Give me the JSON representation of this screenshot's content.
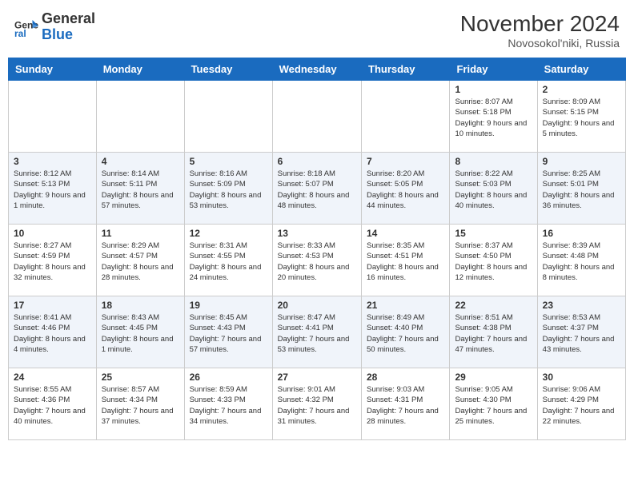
{
  "header": {
    "logo_line1": "General",
    "logo_line2": "Blue",
    "month": "November 2024",
    "location": "Novosokol'niki, Russia"
  },
  "weekdays": [
    "Sunday",
    "Monday",
    "Tuesday",
    "Wednesday",
    "Thursday",
    "Friday",
    "Saturday"
  ],
  "weeks": [
    [
      {
        "day": "",
        "info": ""
      },
      {
        "day": "",
        "info": ""
      },
      {
        "day": "",
        "info": ""
      },
      {
        "day": "",
        "info": ""
      },
      {
        "day": "",
        "info": ""
      },
      {
        "day": "1",
        "info": "Sunrise: 8:07 AM\nSunset: 5:18 PM\nDaylight: 9 hours and 10 minutes."
      },
      {
        "day": "2",
        "info": "Sunrise: 8:09 AM\nSunset: 5:15 PM\nDaylight: 9 hours and 5 minutes."
      }
    ],
    [
      {
        "day": "3",
        "info": "Sunrise: 8:12 AM\nSunset: 5:13 PM\nDaylight: 9 hours and 1 minute."
      },
      {
        "day": "4",
        "info": "Sunrise: 8:14 AM\nSunset: 5:11 PM\nDaylight: 8 hours and 57 minutes."
      },
      {
        "day": "5",
        "info": "Sunrise: 8:16 AM\nSunset: 5:09 PM\nDaylight: 8 hours and 53 minutes."
      },
      {
        "day": "6",
        "info": "Sunrise: 8:18 AM\nSunset: 5:07 PM\nDaylight: 8 hours and 48 minutes."
      },
      {
        "day": "7",
        "info": "Sunrise: 8:20 AM\nSunset: 5:05 PM\nDaylight: 8 hours and 44 minutes."
      },
      {
        "day": "8",
        "info": "Sunrise: 8:22 AM\nSunset: 5:03 PM\nDaylight: 8 hours and 40 minutes."
      },
      {
        "day": "9",
        "info": "Sunrise: 8:25 AM\nSunset: 5:01 PM\nDaylight: 8 hours and 36 minutes."
      }
    ],
    [
      {
        "day": "10",
        "info": "Sunrise: 8:27 AM\nSunset: 4:59 PM\nDaylight: 8 hours and 32 minutes."
      },
      {
        "day": "11",
        "info": "Sunrise: 8:29 AM\nSunset: 4:57 PM\nDaylight: 8 hours and 28 minutes."
      },
      {
        "day": "12",
        "info": "Sunrise: 8:31 AM\nSunset: 4:55 PM\nDaylight: 8 hours and 24 minutes."
      },
      {
        "day": "13",
        "info": "Sunrise: 8:33 AM\nSunset: 4:53 PM\nDaylight: 8 hours and 20 minutes."
      },
      {
        "day": "14",
        "info": "Sunrise: 8:35 AM\nSunset: 4:51 PM\nDaylight: 8 hours and 16 minutes."
      },
      {
        "day": "15",
        "info": "Sunrise: 8:37 AM\nSunset: 4:50 PM\nDaylight: 8 hours and 12 minutes."
      },
      {
        "day": "16",
        "info": "Sunrise: 8:39 AM\nSunset: 4:48 PM\nDaylight: 8 hours and 8 minutes."
      }
    ],
    [
      {
        "day": "17",
        "info": "Sunrise: 8:41 AM\nSunset: 4:46 PM\nDaylight: 8 hours and 4 minutes."
      },
      {
        "day": "18",
        "info": "Sunrise: 8:43 AM\nSunset: 4:45 PM\nDaylight: 8 hours and 1 minute."
      },
      {
        "day": "19",
        "info": "Sunrise: 8:45 AM\nSunset: 4:43 PM\nDaylight: 7 hours and 57 minutes."
      },
      {
        "day": "20",
        "info": "Sunrise: 8:47 AM\nSunset: 4:41 PM\nDaylight: 7 hours and 53 minutes."
      },
      {
        "day": "21",
        "info": "Sunrise: 8:49 AM\nSunset: 4:40 PM\nDaylight: 7 hours and 50 minutes."
      },
      {
        "day": "22",
        "info": "Sunrise: 8:51 AM\nSunset: 4:38 PM\nDaylight: 7 hours and 47 minutes."
      },
      {
        "day": "23",
        "info": "Sunrise: 8:53 AM\nSunset: 4:37 PM\nDaylight: 7 hours and 43 minutes."
      }
    ],
    [
      {
        "day": "24",
        "info": "Sunrise: 8:55 AM\nSunset: 4:36 PM\nDaylight: 7 hours and 40 minutes."
      },
      {
        "day": "25",
        "info": "Sunrise: 8:57 AM\nSunset: 4:34 PM\nDaylight: 7 hours and 37 minutes."
      },
      {
        "day": "26",
        "info": "Sunrise: 8:59 AM\nSunset: 4:33 PM\nDaylight: 7 hours and 34 minutes."
      },
      {
        "day": "27",
        "info": "Sunrise: 9:01 AM\nSunset: 4:32 PM\nDaylight: 7 hours and 31 minutes."
      },
      {
        "day": "28",
        "info": "Sunrise: 9:03 AM\nSunset: 4:31 PM\nDaylight: 7 hours and 28 minutes."
      },
      {
        "day": "29",
        "info": "Sunrise: 9:05 AM\nSunset: 4:30 PM\nDaylight: 7 hours and 25 minutes."
      },
      {
        "day": "30",
        "info": "Sunrise: 9:06 AM\nSunset: 4:29 PM\nDaylight: 7 hours and 22 minutes."
      }
    ]
  ]
}
